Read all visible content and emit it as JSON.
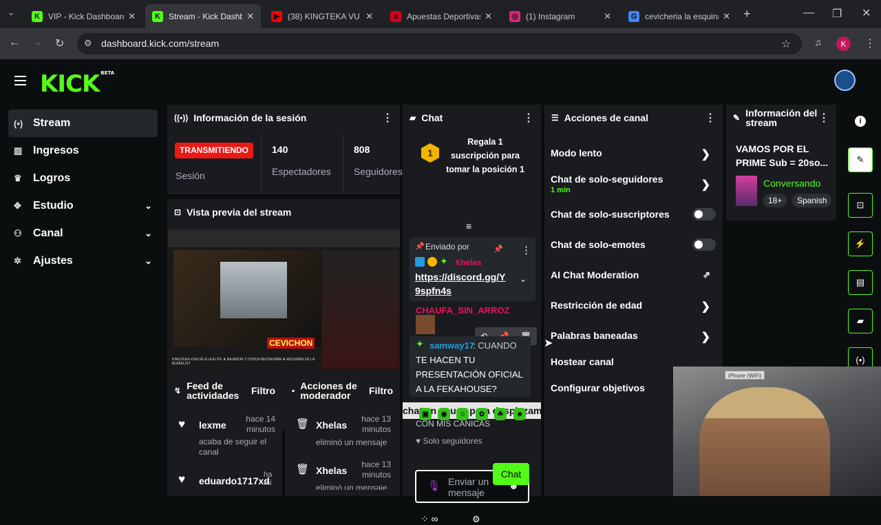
{
  "browser": {
    "tabs": [
      {
        "title": "VIP - Kick Dashboard",
        "favicon": "K",
        "color": "#53fc18",
        "active": false
      },
      {
        "title": "Stream - Kick Dashbo",
        "favicon": "K",
        "color": "#53fc18",
        "active": true
      },
      {
        "title": "(38) KINGTEKA VU",
        "favicon": "▶",
        "color": "#ff0000",
        "active": false
      },
      {
        "title": "Apuestas Deportivas",
        "favicon": "a",
        "color": "#d4001a",
        "active": false
      },
      {
        "title": "(1) Instagram",
        "favicon": "◎",
        "color": "#d62976",
        "active": false
      },
      {
        "title": "cevicheria la esquina",
        "favicon": "G",
        "color": "#4285f4",
        "active": false
      }
    ],
    "url": "dashboard.kick.com/stream",
    "profile_initial": "K"
  },
  "brand": {
    "logo": "KICK",
    "beta": "BETA"
  },
  "sidebar": {
    "items": [
      {
        "label": "Stream",
        "icon": "broadcast-icon",
        "glyph": "(•)",
        "active": true,
        "chevron": false
      },
      {
        "label": "Ingresos",
        "icon": "revenue-icon",
        "glyph": "▥",
        "active": false,
        "chevron": false
      },
      {
        "label": "Logros",
        "icon": "trophy-icon",
        "glyph": "♛",
        "active": false,
        "chevron": false
      },
      {
        "label": "Estudio",
        "icon": "studio-icon",
        "glyph": "✥",
        "active": false,
        "chevron": true
      },
      {
        "label": "Canal",
        "icon": "channel-icon",
        "glyph": "⚇",
        "active": false,
        "chevron": true
      },
      {
        "label": "Ajustes",
        "icon": "settings-icon",
        "glyph": "✲",
        "active": false,
        "chevron": true
      }
    ]
  },
  "session": {
    "title": "Información de la sesión",
    "status_badge": "TRANSMITIENDO",
    "status_label": "Sesión",
    "viewers": "140",
    "viewers_label": "Espectadores",
    "followers": "808",
    "followers_label": "Seguidores"
  },
  "preview": {
    "title": "Vista previa del stream",
    "overlay_text": "CEVICHON",
    "ticker": "KINGTEKA VUELVE A LA ELITE ♛ RAJADOR Y CHOCA RESTAURAN ♛ RESUMEN DE LA BLAKELIST"
  },
  "activity": {
    "title": "Feed de actividades",
    "filter": "Filtro",
    "items": [
      {
        "user": "lexme",
        "time": "hace 14 minutos",
        "action": "acaba de seguir el canal"
      },
      {
        "user": "eduardo1717xd",
        "time": "ha mi",
        "action": ""
      }
    ]
  },
  "modactions": {
    "title": "Acciones de moderador",
    "filter": "Filtro",
    "items": [
      {
        "user": "Xhelas",
        "time": "hace 13 minutos",
        "action": "eliminó un mensaje"
      },
      {
        "user": "Xhelas",
        "time": "hace 13 minutos",
        "action": "eliminó un mensaje"
      }
    ]
  },
  "chat": {
    "title": "Chat",
    "gift_text": "Regala 1 suscripción para tomar la posición 1",
    "gift_rank": "1",
    "pinned_label": "Enviado por",
    "pinned_user": "Xhelas",
    "pinned_link": "https://discord.gg/Y9spfn4s",
    "msg1_user": "CHAUFA_SIN_ARROZ",
    "msg2_user": "samway17",
    "msg2_prefix": ": CUANDO",
    "msg2_text": "TE HACEN TU PRESENTACIÓN OFICIAL A LA FEKAHOUSE?",
    "paused_banner": "chat en pausa para desplazamiento",
    "partial_line": "CON MIS CANICAS",
    "followers_only": "Solo seguidores",
    "input_placeholder": "Enviar un mensaje",
    "send_label": "Chat",
    "points_label": "∞"
  },
  "channel_actions": {
    "title": "Acciones de canal",
    "rows": [
      {
        "label": "Modo lento",
        "sub": "",
        "control": "chevron"
      },
      {
        "label": "Chat de solo-seguidores",
        "sub": "1 min",
        "control": "chevron"
      },
      {
        "label": "Chat de solo-suscriptores",
        "sub": "",
        "control": "toggle"
      },
      {
        "label": "Chat de solo-emotes",
        "sub": "",
        "control": "toggle"
      },
      {
        "label": "AI Chat Moderation",
        "sub": "",
        "control": "external"
      },
      {
        "label": "Restricción de edad",
        "sub": "",
        "control": "chevron"
      },
      {
        "label": "Palabras baneadas",
        "sub": "",
        "control": "chevron"
      },
      {
        "label": "Hostear canal",
        "sub": "",
        "control": "none"
      },
      {
        "label": "Configurar objetivos",
        "sub": "",
        "control": "none"
      }
    ]
  },
  "stream_info": {
    "title": "Información del stream",
    "stream_title": "VAMOS POR EL PRIME Sub = 20so...",
    "category": "Conversando",
    "tags": [
      "18+",
      "Spanish"
    ]
  },
  "webcam": {
    "label": "iPhone (WiFi)"
  }
}
